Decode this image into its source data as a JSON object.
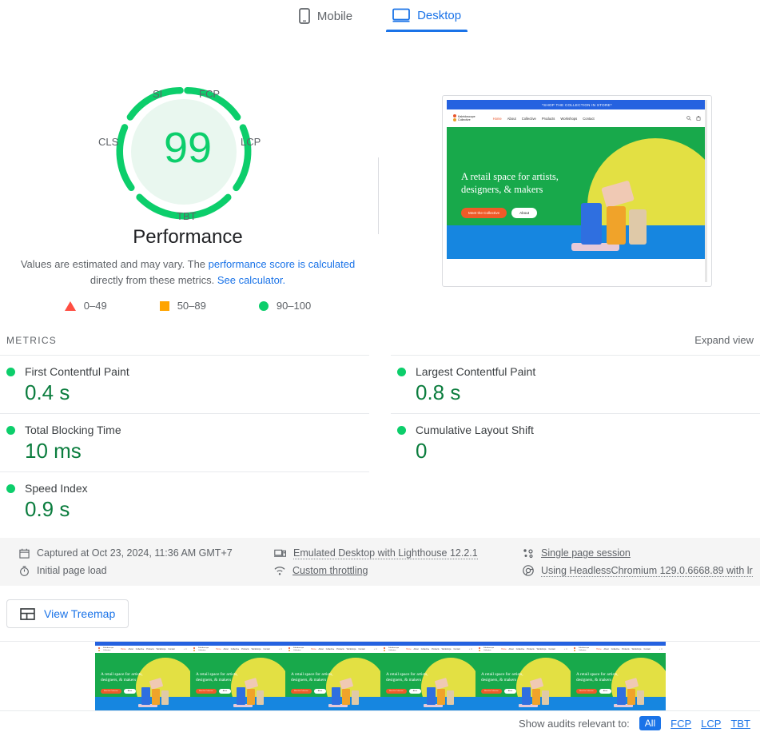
{
  "form_factor_tabs": [
    {
      "label": "Mobile",
      "icon": "mobile-icon",
      "active": false
    },
    {
      "label": "Desktop",
      "icon": "desktop-icon",
      "active": true
    }
  ],
  "gauge": {
    "score": "99",
    "title": "Performance",
    "arc_labels": {
      "si": "SI",
      "fcp": "FCP",
      "lcp": "LCP",
      "tbt": "TBT",
      "cls": "CLS"
    },
    "color": "#0cce6b",
    "note_part1": "Values are estimated and may vary. The ",
    "note_link1": "performance score is calculated",
    "note_part2": " directly from these metrics. ",
    "note_link2": "See calculator.",
    "legend": [
      {
        "swatch": "triangle-icon",
        "range": "0–49",
        "color": "#ff4e42"
      },
      {
        "swatch": "square-icon",
        "range": "50–89",
        "color": "#ffa400"
      },
      {
        "swatch": "circle-icon",
        "range": "90–100",
        "color": "#0cce6b"
      }
    ]
  },
  "thumbnail": {
    "banner": "*SHOP THE COLLECTION IN STORE*",
    "logo_line1": "Kaleidoscope",
    "logo_line2": "Collective",
    "nav": [
      "Home",
      "About",
      "Collective",
      "Products",
      "Workshops",
      "Contact"
    ],
    "hero_line1": "A retail space for artists,",
    "hero_line2": "designers, & makers",
    "cta_primary": "Meet the Collective",
    "cta_secondary": "About"
  },
  "metrics_section": {
    "label": "METRICS",
    "expand_view": "Expand view",
    "items": [
      {
        "name": "First Contentful Paint",
        "value": "0.4 s",
        "status_color": "#0cce6b"
      },
      {
        "name": "Largest Contentful Paint",
        "value": "0.8 s",
        "status_color": "#0cce6b"
      },
      {
        "name": "Total Blocking Time",
        "value": "10 ms",
        "status_color": "#0cce6b"
      },
      {
        "name": "Cumulative Layout Shift",
        "value": "0",
        "status_color": "#0cce6b"
      },
      {
        "name": "Speed Index",
        "value": "0.9 s",
        "status_color": "#0cce6b"
      }
    ]
  },
  "environment": {
    "captured_at": "Captured at Oct 23, 2024, 11:36 AM GMT+7",
    "page_load": "Initial page load",
    "emulation": "Emulated Desktop with Lighthouse 12.2.1",
    "throttling": "Custom throttling",
    "session": "Single page session",
    "user_agent": "Using HeadlessChromium 129.0.6668.89 with lr"
  },
  "treemap_button": {
    "label": "View Treemap",
    "icon": "treemap-icon"
  },
  "audit_filter": {
    "label": "Show audits relevant to:",
    "options": [
      "All",
      "FCP",
      "LCP",
      "TBT"
    ],
    "selected": "All"
  }
}
